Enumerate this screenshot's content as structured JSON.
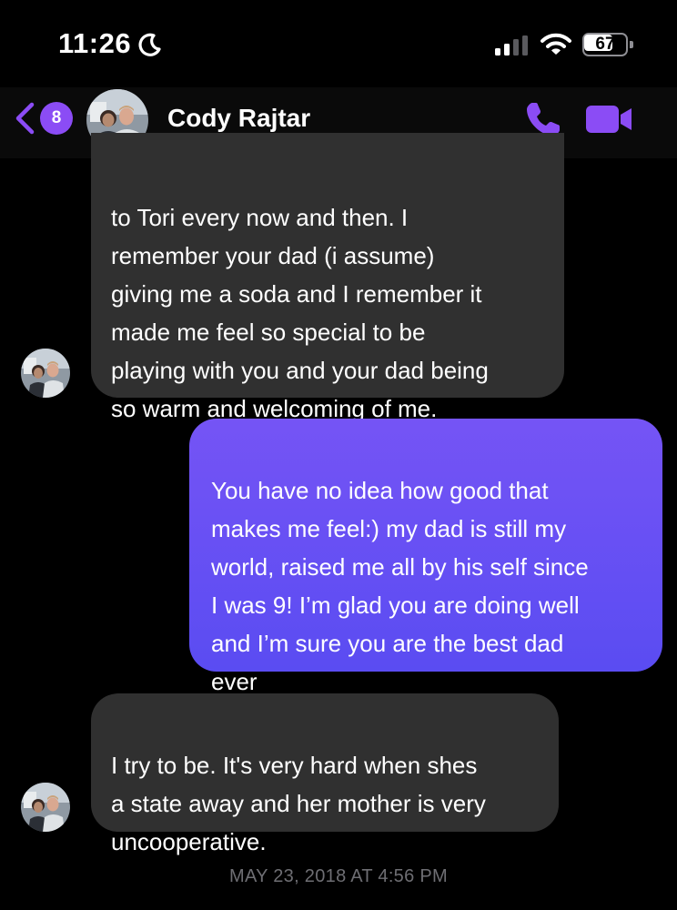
{
  "status_bar": {
    "time": "11:26",
    "battery_level": "67",
    "battery_percent": 67,
    "focus_icon": "moon-icon",
    "signal_icon": "cellular-signal-icon",
    "wifi_icon": "wifi-icon"
  },
  "header": {
    "unread_count": "8",
    "contact_name": "Cody Rajtar",
    "back_icon": "chevron-left-icon",
    "call_icon": "phone-icon",
    "video_icon": "video-camera-icon",
    "accent_color": "#8b4cf5"
  },
  "messages": [
    {
      "direction": "incoming",
      "text": "to Tori every now and then. I\nremember your dad (i assume)\ngiving me a soda and I remember it\nmade me feel so special to be\nplaying with you and your dad being\nso warm and welcoming of me."
    },
    {
      "direction": "outgoing",
      "text": "You have no idea how good that\nmakes me feel:) my dad is still my\nworld, raised me all by his self since\nI was 9! I’m glad you are doing well\nand I’m sure you are the best dad\never"
    },
    {
      "direction": "incoming",
      "text": "I try to be. It's very hard when shes\na state away and her mother is very\nuncooperative."
    }
  ],
  "timestamp": "MAY 23, 2018 AT 4:56 PM",
  "colors": {
    "background": "#000000",
    "incoming_bubble": "#303030",
    "outgoing_bubble_top": "#7554f5",
    "outgoing_bubble_bottom": "#5a4cf2"
  }
}
